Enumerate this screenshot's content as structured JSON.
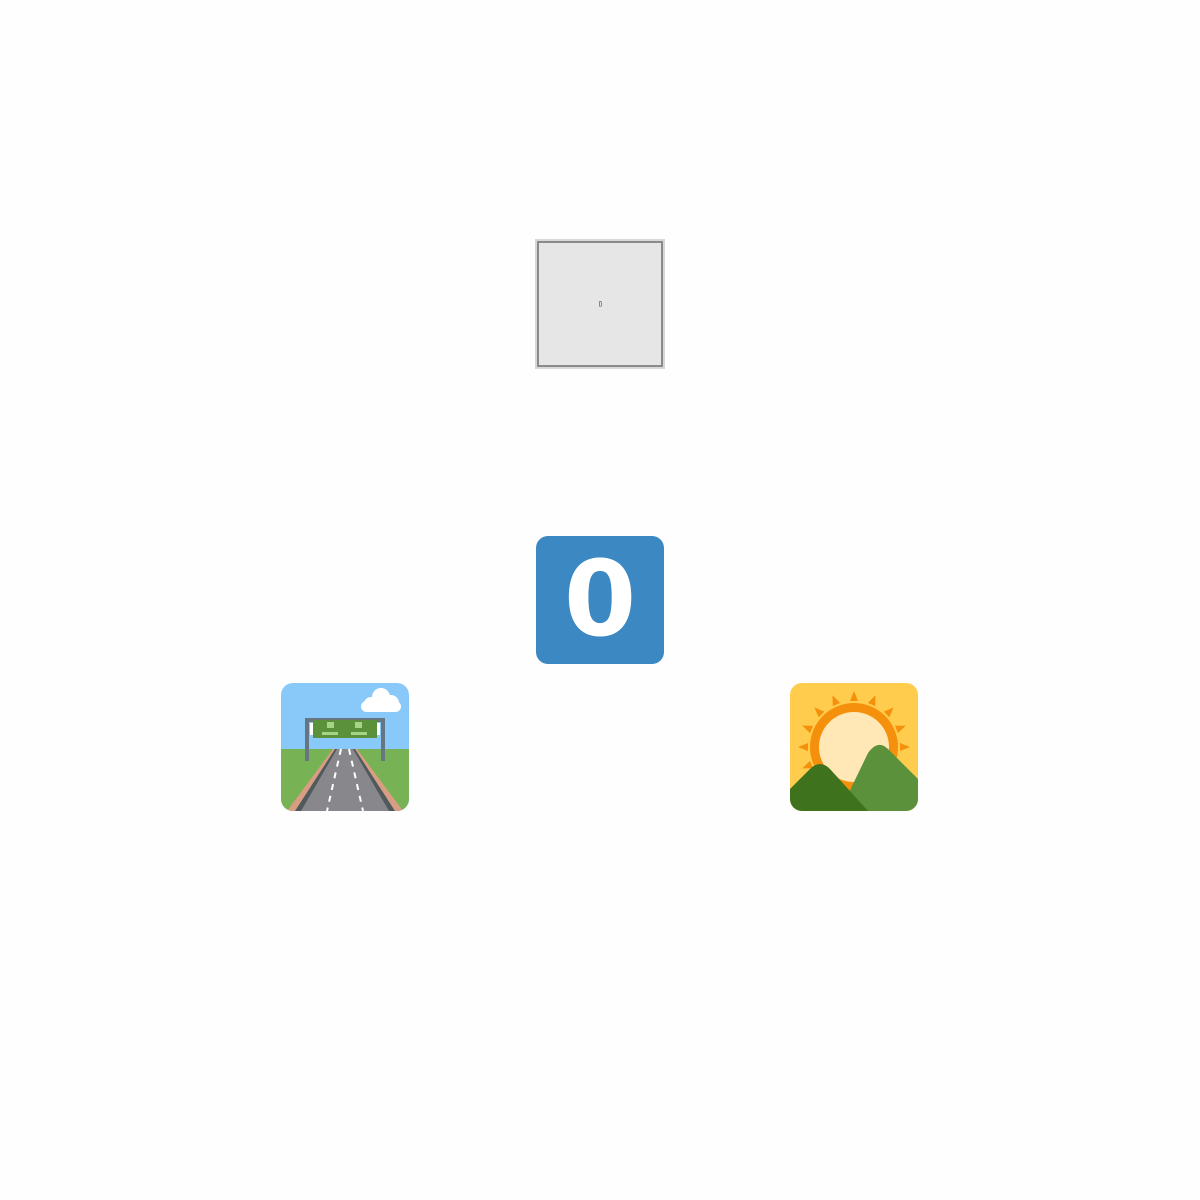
{
  "placeholder": {
    "glyph": "▯",
    "background": "#e6e6e6"
  },
  "keycap": {
    "digit": "0",
    "color": "#3b88c3"
  },
  "icons": [
    {
      "name": "motorway-icon"
    },
    {
      "name": "sunrise-over-mountains-icon"
    }
  ]
}
